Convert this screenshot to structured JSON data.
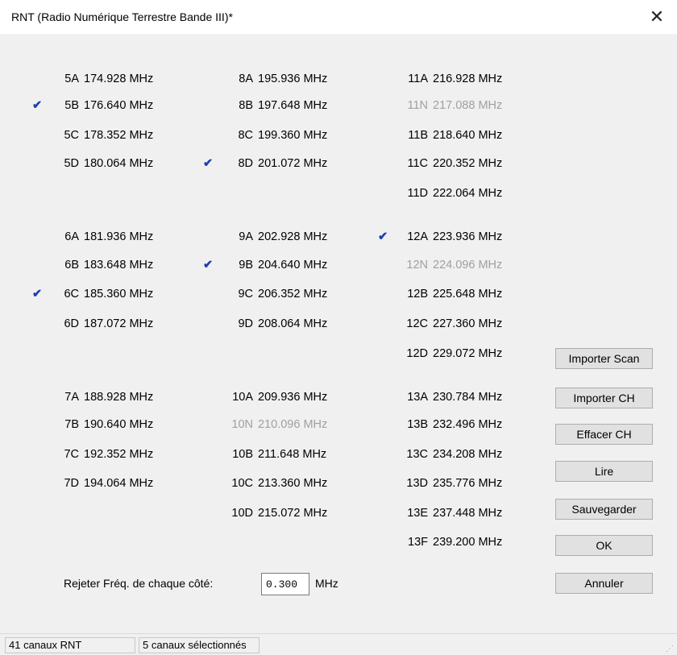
{
  "window": {
    "title": "RNT (Radio Numérique Terrestre Bande III)*",
    "close_glyph": "✕"
  },
  "channels": {
    "col1": [
      {
        "code": "5A",
        "freq": "174.928 MHz",
        "checked": false,
        "enabled": true
      },
      {
        "code": "5B",
        "freq": "176.640 MHz",
        "checked": true,
        "enabled": true
      },
      {
        "code": "5C",
        "freq": "178.352 MHz",
        "checked": false,
        "enabled": true
      },
      {
        "code": "5D",
        "freq": "180.064 MHz",
        "checked": false,
        "enabled": true
      },
      {
        "code": "6A",
        "freq": "181.936 MHz",
        "checked": false,
        "enabled": true
      },
      {
        "code": "6B",
        "freq": "183.648 MHz",
        "checked": false,
        "enabled": true
      },
      {
        "code": "6C",
        "freq": "185.360 MHz",
        "checked": true,
        "enabled": true
      },
      {
        "code": "6D",
        "freq": "187.072 MHz",
        "checked": false,
        "enabled": true
      },
      {
        "code": "7A",
        "freq": "188.928 MHz",
        "checked": false,
        "enabled": true
      },
      {
        "code": "7B",
        "freq": "190.640 MHz",
        "checked": false,
        "enabled": true
      },
      {
        "code": "7C",
        "freq": "192.352 MHz",
        "checked": false,
        "enabled": true
      },
      {
        "code": "7D",
        "freq": "194.064 MHz",
        "checked": false,
        "enabled": true
      }
    ],
    "col2": [
      {
        "code": "8A",
        "freq": "195.936 MHz",
        "checked": false,
        "enabled": true
      },
      {
        "code": "8B",
        "freq": "197.648 MHz",
        "checked": false,
        "enabled": true
      },
      {
        "code": "8C",
        "freq": "199.360 MHz",
        "checked": false,
        "enabled": true
      },
      {
        "code": "8D",
        "freq": "201.072 MHz",
        "checked": true,
        "enabled": true
      },
      {
        "code": "9A",
        "freq": "202.928 MHz",
        "checked": false,
        "enabled": true
      },
      {
        "code": "9B",
        "freq": "204.640 MHz",
        "checked": true,
        "enabled": true
      },
      {
        "code": "9C",
        "freq": "206.352 MHz",
        "checked": false,
        "enabled": true
      },
      {
        "code": "9D",
        "freq": "208.064 MHz",
        "checked": false,
        "enabled": true
      },
      {
        "code": "10A",
        "freq": "209.936 MHz",
        "checked": false,
        "enabled": true
      },
      {
        "code": "10N",
        "freq": "210.096 MHz",
        "checked": false,
        "enabled": false
      },
      {
        "code": "10B",
        "freq": "211.648 MHz",
        "checked": false,
        "enabled": true
      },
      {
        "code": "10C",
        "freq": "213.360 MHz",
        "checked": false,
        "enabled": true
      },
      {
        "code": "10D",
        "freq": "215.072 MHz",
        "checked": false,
        "enabled": true
      }
    ],
    "col3": [
      {
        "code": "11A",
        "freq": "216.928 MHz",
        "checked": false,
        "enabled": true
      },
      {
        "code": "11N",
        "freq": "217.088 MHz",
        "checked": false,
        "enabled": false
      },
      {
        "code": "11B",
        "freq": "218.640 MHz",
        "checked": false,
        "enabled": true
      },
      {
        "code": "11C",
        "freq": "220.352 MHz",
        "checked": false,
        "enabled": true
      },
      {
        "code": "11D",
        "freq": "222.064 MHz",
        "checked": false,
        "enabled": true
      },
      {
        "code": "12A",
        "freq": "223.936 MHz",
        "checked": true,
        "enabled": true
      },
      {
        "code": "12N",
        "freq": "224.096 MHz",
        "checked": false,
        "enabled": false
      },
      {
        "code": "12B",
        "freq": "225.648 MHz",
        "checked": false,
        "enabled": true
      },
      {
        "code": "12C",
        "freq": "227.360 MHz",
        "checked": false,
        "enabled": true
      },
      {
        "code": "12D",
        "freq": "229.072 MHz",
        "checked": false,
        "enabled": true
      },
      {
        "code": "13A",
        "freq": "230.784 MHz",
        "checked": false,
        "enabled": true
      },
      {
        "code": "13B",
        "freq": "232.496 MHz",
        "checked": false,
        "enabled": true
      },
      {
        "code": "13C",
        "freq": "234.208 MHz",
        "checked": false,
        "enabled": true
      },
      {
        "code": "13D",
        "freq": "235.776 MHz",
        "checked": false,
        "enabled": true
      },
      {
        "code": "13E",
        "freq": "237.448 MHz",
        "checked": false,
        "enabled": true
      },
      {
        "code": "13F",
        "freq": "239.200 MHz",
        "checked": false,
        "enabled": true
      }
    ]
  },
  "buttons": {
    "importer_scan": "Importer Scan",
    "importer_ch": "Importer CH",
    "effacer_ch": "Effacer CH",
    "lire": "Lire",
    "sauvegarder": "Sauvegarder",
    "ok": "OK",
    "annuler": "Annuler"
  },
  "reject": {
    "label": "Rejeter Fréq. de chaque côté:",
    "value": "0.300",
    "unit": "MHz"
  },
  "status": {
    "count": "41 canaux RNT",
    "selected": "5 canaux sélectionnés"
  },
  "icons": {
    "check": "check-icon",
    "close": "close-icon",
    "grip": "resize-grip-icon"
  },
  "colors": {
    "check": "#1a3fb0",
    "disabled_text": "#a0a0a0",
    "dialog_bg": "#f0f0f0"
  }
}
